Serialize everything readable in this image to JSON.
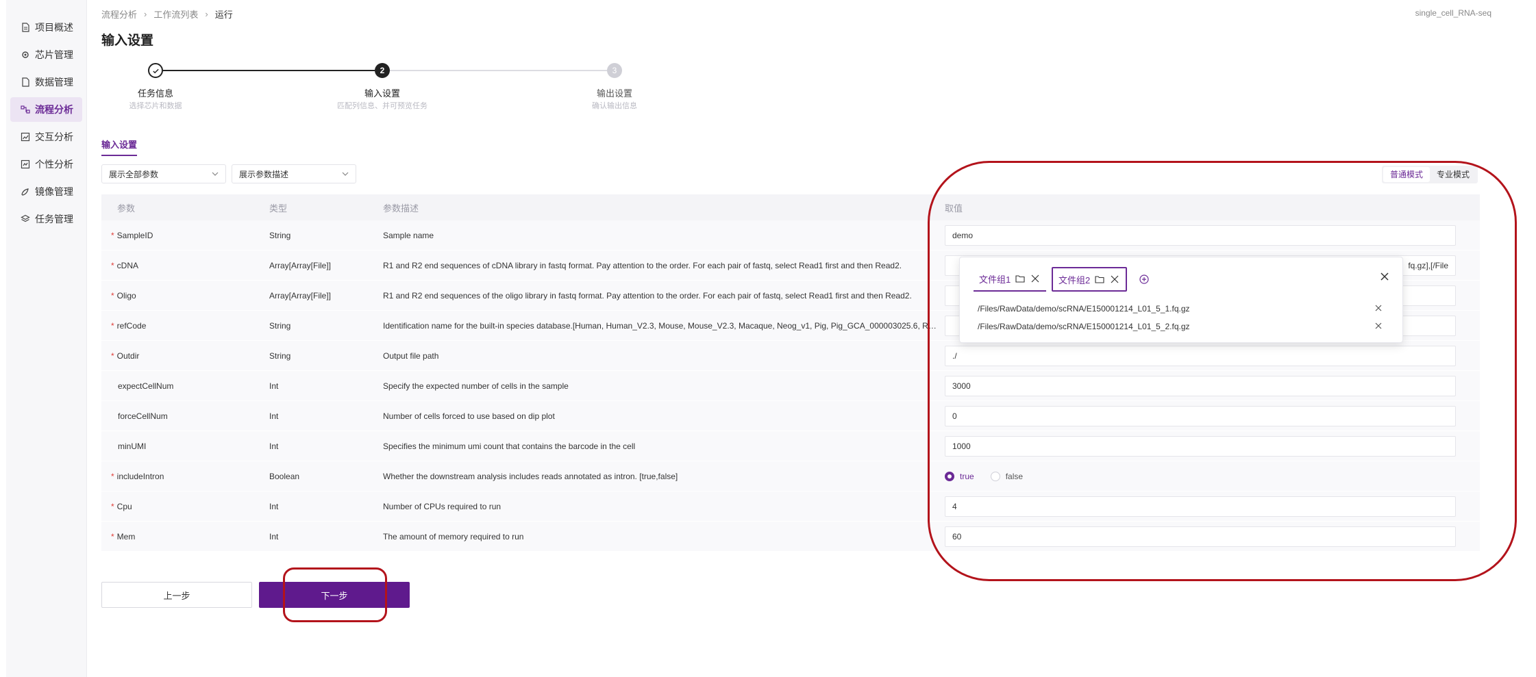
{
  "sidebar": {
    "items": [
      {
        "label": "项目概述",
        "icon": "document-icon"
      },
      {
        "label": "芯片管理",
        "icon": "chip-icon"
      },
      {
        "label": "数据管理",
        "icon": "file-icon"
      },
      {
        "label": "流程分析",
        "icon": "workflow-icon"
      },
      {
        "label": "交互分析",
        "icon": "chart-icon"
      },
      {
        "label": "个性分析",
        "icon": "analytics-icon"
      },
      {
        "label": "镜像管理",
        "icon": "image-icon"
      },
      {
        "label": "任务管理",
        "icon": "layers-icon"
      }
    ],
    "active_index": 3
  },
  "breadcrumb": [
    "流程分析",
    "工作流列表",
    "运行"
  ],
  "project_name": "single_cell_RNA-seq",
  "page_title": "输入设置",
  "steps": [
    {
      "number": "1",
      "title": "任务信息",
      "desc": "选择芯片和数据",
      "state": "done"
    },
    {
      "number": "2",
      "title": "输入设置",
      "desc": "匹配列信息、并可预览任务",
      "state": "current"
    },
    {
      "number": "3",
      "title": "输出设置",
      "desc": "确认输出信息",
      "state": "pending"
    }
  ],
  "section_tab": "输入设置",
  "filters": {
    "params_select": "展示全部参数",
    "desc_select": "展示参数描述"
  },
  "mode_toggle": {
    "normal": "普通模式",
    "expert": "专业模式",
    "selected": "normal"
  },
  "table": {
    "headers": {
      "param": "参数",
      "type": "类型",
      "desc": "参数描述",
      "value": "取值"
    },
    "rows": [
      {
        "required": true,
        "param": "SampleID",
        "type": "String",
        "desc": "Sample name",
        "value": "demo"
      },
      {
        "required": true,
        "param": "cDNA",
        "type": "Array[Array[File]]",
        "desc": "R1 and R2 end sequences of cDNA library in fastq format. Pay attention to the order. For each pair of fastq, select Read1 first and then Read2.",
        "value": "fq.gz],[/File"
      },
      {
        "required": true,
        "param": "Oligo",
        "type": "Array[Array[File]]",
        "desc": "R1 and R2 end sequences of the oligo library in fastq format. Pay attention to the order. For each pair of fastq, select Read1 first and then Read2.",
        "value": ""
      },
      {
        "required": true,
        "param": "refCode",
        "type": "String",
        "desc": "Identification name for the built-in species database.[Human, Human_V2.3, Mouse, Mouse_V2.3, Macaque, Neog_v1, Pig, Pig_GCA_000003025.6, Rab...",
        "value": ""
      },
      {
        "required": true,
        "param": "Outdir",
        "type": "String",
        "desc": "Output file path",
        "value": "./"
      },
      {
        "required": false,
        "param": "expectCellNum",
        "type": "Int",
        "desc": "Specify the expected number of cells in the sample",
        "value": "3000"
      },
      {
        "required": false,
        "param": "forceCellNum",
        "type": "Int",
        "desc": "Number of cells forced to use based on dip plot",
        "value": "0"
      },
      {
        "required": false,
        "param": "minUMI",
        "type": "Int",
        "desc": "Specifies the minimum umi count that contains the barcode in the cell",
        "value": "1000"
      },
      {
        "required": true,
        "param": "includeIntron",
        "type": "Boolean",
        "desc": "Whether the downstream analysis includes reads annotated as intron. [true,false]",
        "value": "",
        "radio": {
          "options": [
            "true",
            "false"
          ],
          "selected": "true"
        }
      },
      {
        "required": true,
        "param": "Cpu",
        "type": "Int",
        "desc": "Number of CPUs required to run",
        "value": "4"
      },
      {
        "required": true,
        "param": "Mem",
        "type": "Int",
        "desc": "The amount of memory required to run",
        "value": "60"
      }
    ]
  },
  "file_popup": {
    "tabs": [
      "文件组1",
      "文件组2"
    ],
    "files": [
      "/Files/RawData/demo/scRNA/E150001214_L01_5_1.fq.gz",
      "/Files/RawData/demo/scRNA/E150001214_L01_5_2.fq.gz"
    ]
  },
  "buttons": {
    "prev": "上一步",
    "next": "下一步"
  },
  "colors": {
    "accent": "#5f1a8d",
    "annotation": "#b3131b",
    "required": "#e0403a"
  }
}
